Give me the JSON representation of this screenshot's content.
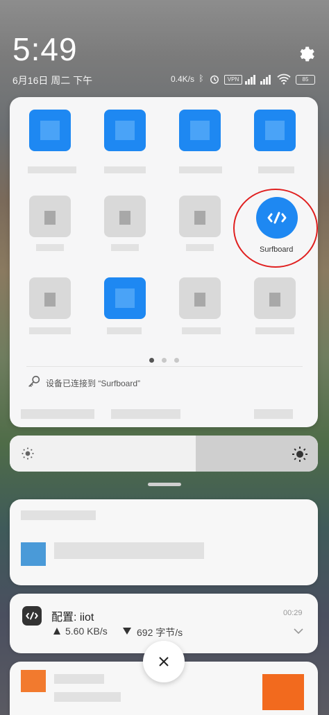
{
  "status": {
    "time": "5:49",
    "date": "6月16日 周二 下午",
    "net_speed": "0.4K/s",
    "vpn": "VPN",
    "battery": "85"
  },
  "quick_panel": {
    "surfboard_label": "Surfboard",
    "connected_text": "设备已连接到 “Surfboard”",
    "page_indicator": {
      "pages": 3,
      "active": 1
    }
  },
  "notifications": {
    "surfboard": {
      "title": "配置: iiot",
      "time": "00:29",
      "upload": "5.60 KB/s",
      "download": "692 字节/s"
    }
  },
  "colors": {
    "accent": "#1e88f2",
    "highlight_ring": "#e02020"
  }
}
